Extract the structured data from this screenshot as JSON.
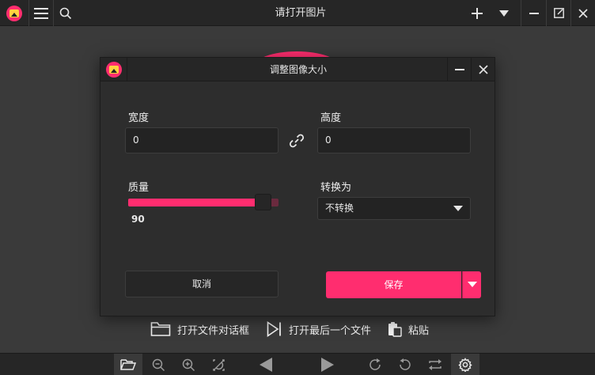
{
  "app": {
    "title": "请打开图片",
    "accent": "#ff2d6f"
  },
  "titlebar": {
    "icons": [
      "app-logo-icon",
      "menu-icon",
      "search-icon",
      "plus-icon",
      "chevron-down-icon",
      "minimize-icon",
      "restore-icon",
      "close-icon"
    ]
  },
  "dialog": {
    "title": "调整图像大小",
    "width_label": "宽度",
    "width_value": "0",
    "height_label": "高度",
    "height_value": "0",
    "quality_label": "质量",
    "quality_value": "90",
    "quality_fraction": 0.9,
    "convert_label": "转换为",
    "convert_value": "不转换",
    "cancel_label": "取消",
    "save_label": "保存"
  },
  "quick_actions": {
    "open_dialog": "打开文件对话框",
    "open_last": "打开最后一个文件",
    "paste": "粘贴"
  },
  "bottombar": {
    "icons": [
      "folder-open-icon",
      "zoom-out-icon",
      "zoom-in-icon",
      "fit-icon",
      "prev-icon",
      "next-icon",
      "rotate-right-icon",
      "rotate-left-icon",
      "flip-icon",
      "settings-icon"
    ]
  }
}
